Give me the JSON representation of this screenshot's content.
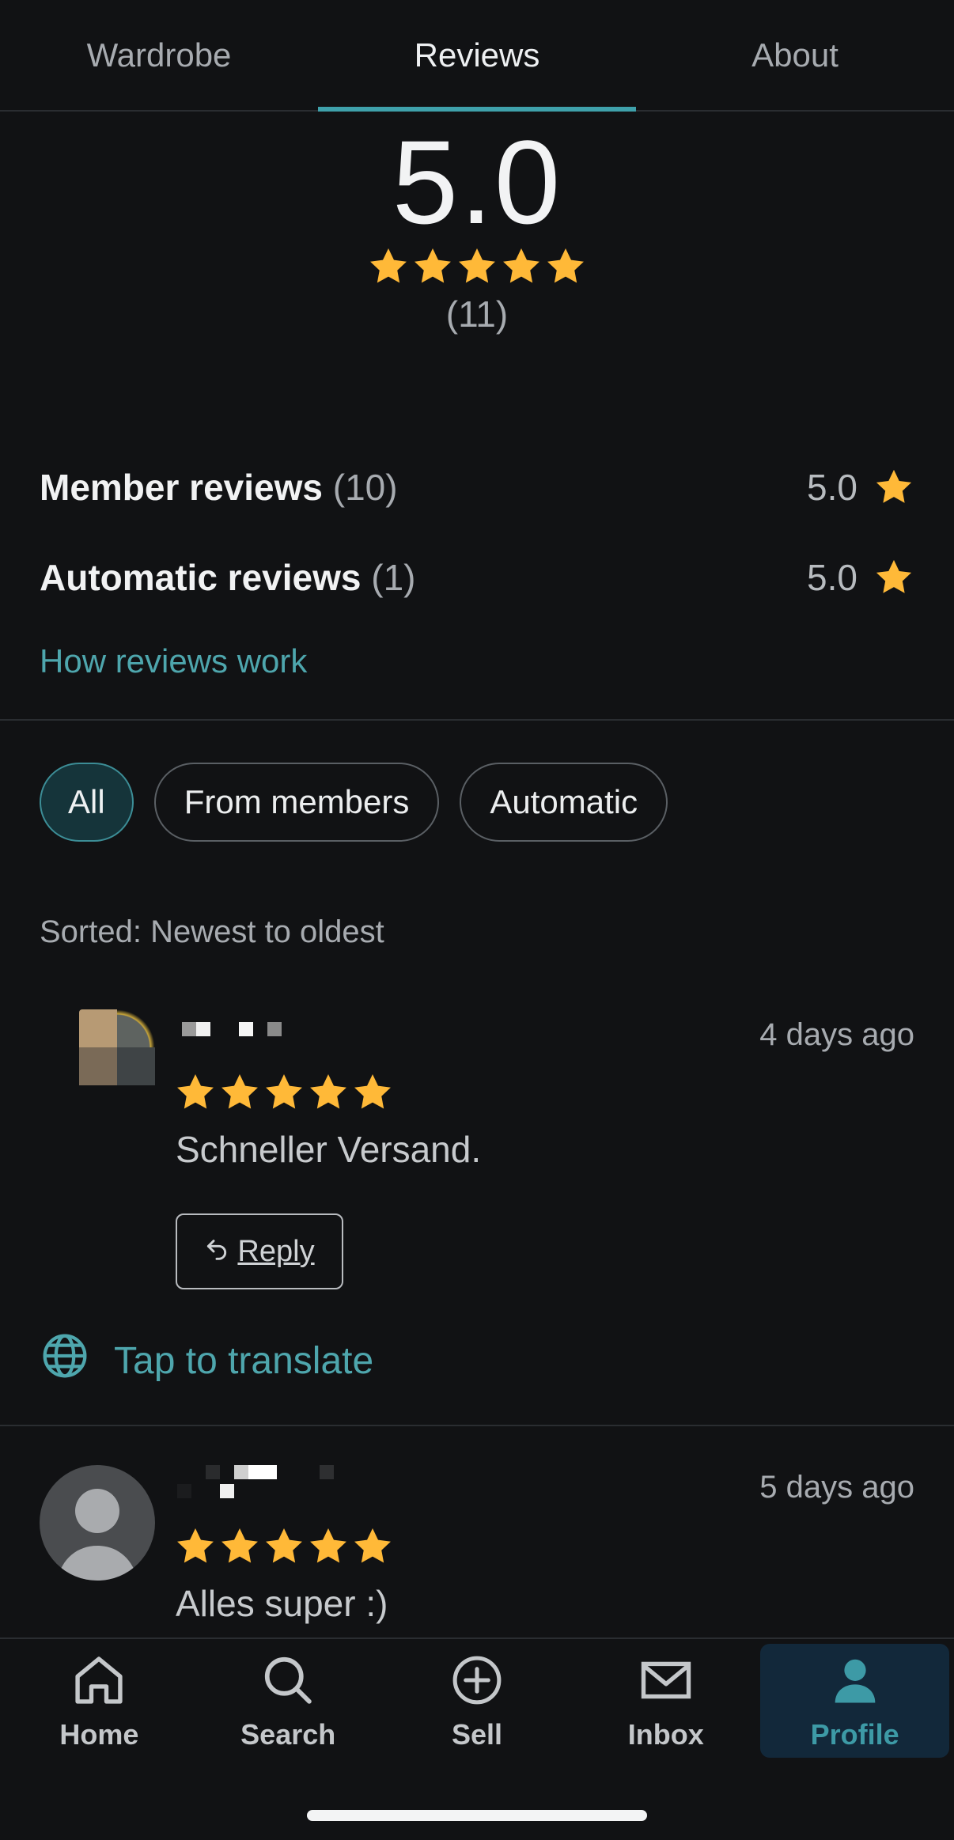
{
  "tabs": [
    {
      "label": "Wardrobe",
      "active": false
    },
    {
      "label": "Reviews",
      "active": true
    },
    {
      "label": "About",
      "active": false
    }
  ],
  "summary": {
    "rating": "5.0",
    "stars": 5,
    "count": "(11)"
  },
  "breakdown": {
    "member": {
      "label": "Member reviews",
      "count": "(10)",
      "value": "5.0"
    },
    "automatic": {
      "label": "Automatic reviews",
      "count": "(1)",
      "value": "5.0"
    }
  },
  "how_link": "How reviews work",
  "filters": [
    {
      "label": "All",
      "active": true
    },
    {
      "label": "From members",
      "active": false
    },
    {
      "label": "Automatic",
      "active": false
    }
  ],
  "sorted_label": "Sorted: Newest to oldest",
  "reviews": [
    {
      "date": "4 days ago",
      "stars": 5,
      "text": "Schneller Versand.",
      "reply_label": "Reply",
      "translate_label": "Tap to translate"
    },
    {
      "date": "5 days ago",
      "stars": 5,
      "text": "Alles super :)"
    }
  ],
  "nav": [
    {
      "label": "Home",
      "icon": "home-icon",
      "active": false
    },
    {
      "label": "Search",
      "icon": "search-icon",
      "active": false
    },
    {
      "label": "Sell",
      "icon": "plus-circle-icon",
      "active": false
    },
    {
      "label": "Inbox",
      "icon": "mail-icon",
      "active": false
    },
    {
      "label": "Profile",
      "icon": "profile-icon",
      "active": true
    }
  ],
  "colors": {
    "background": "#111214",
    "accent": "#3fa1ab",
    "star": "#ffb938",
    "nav_active_bg": "#12283a"
  }
}
